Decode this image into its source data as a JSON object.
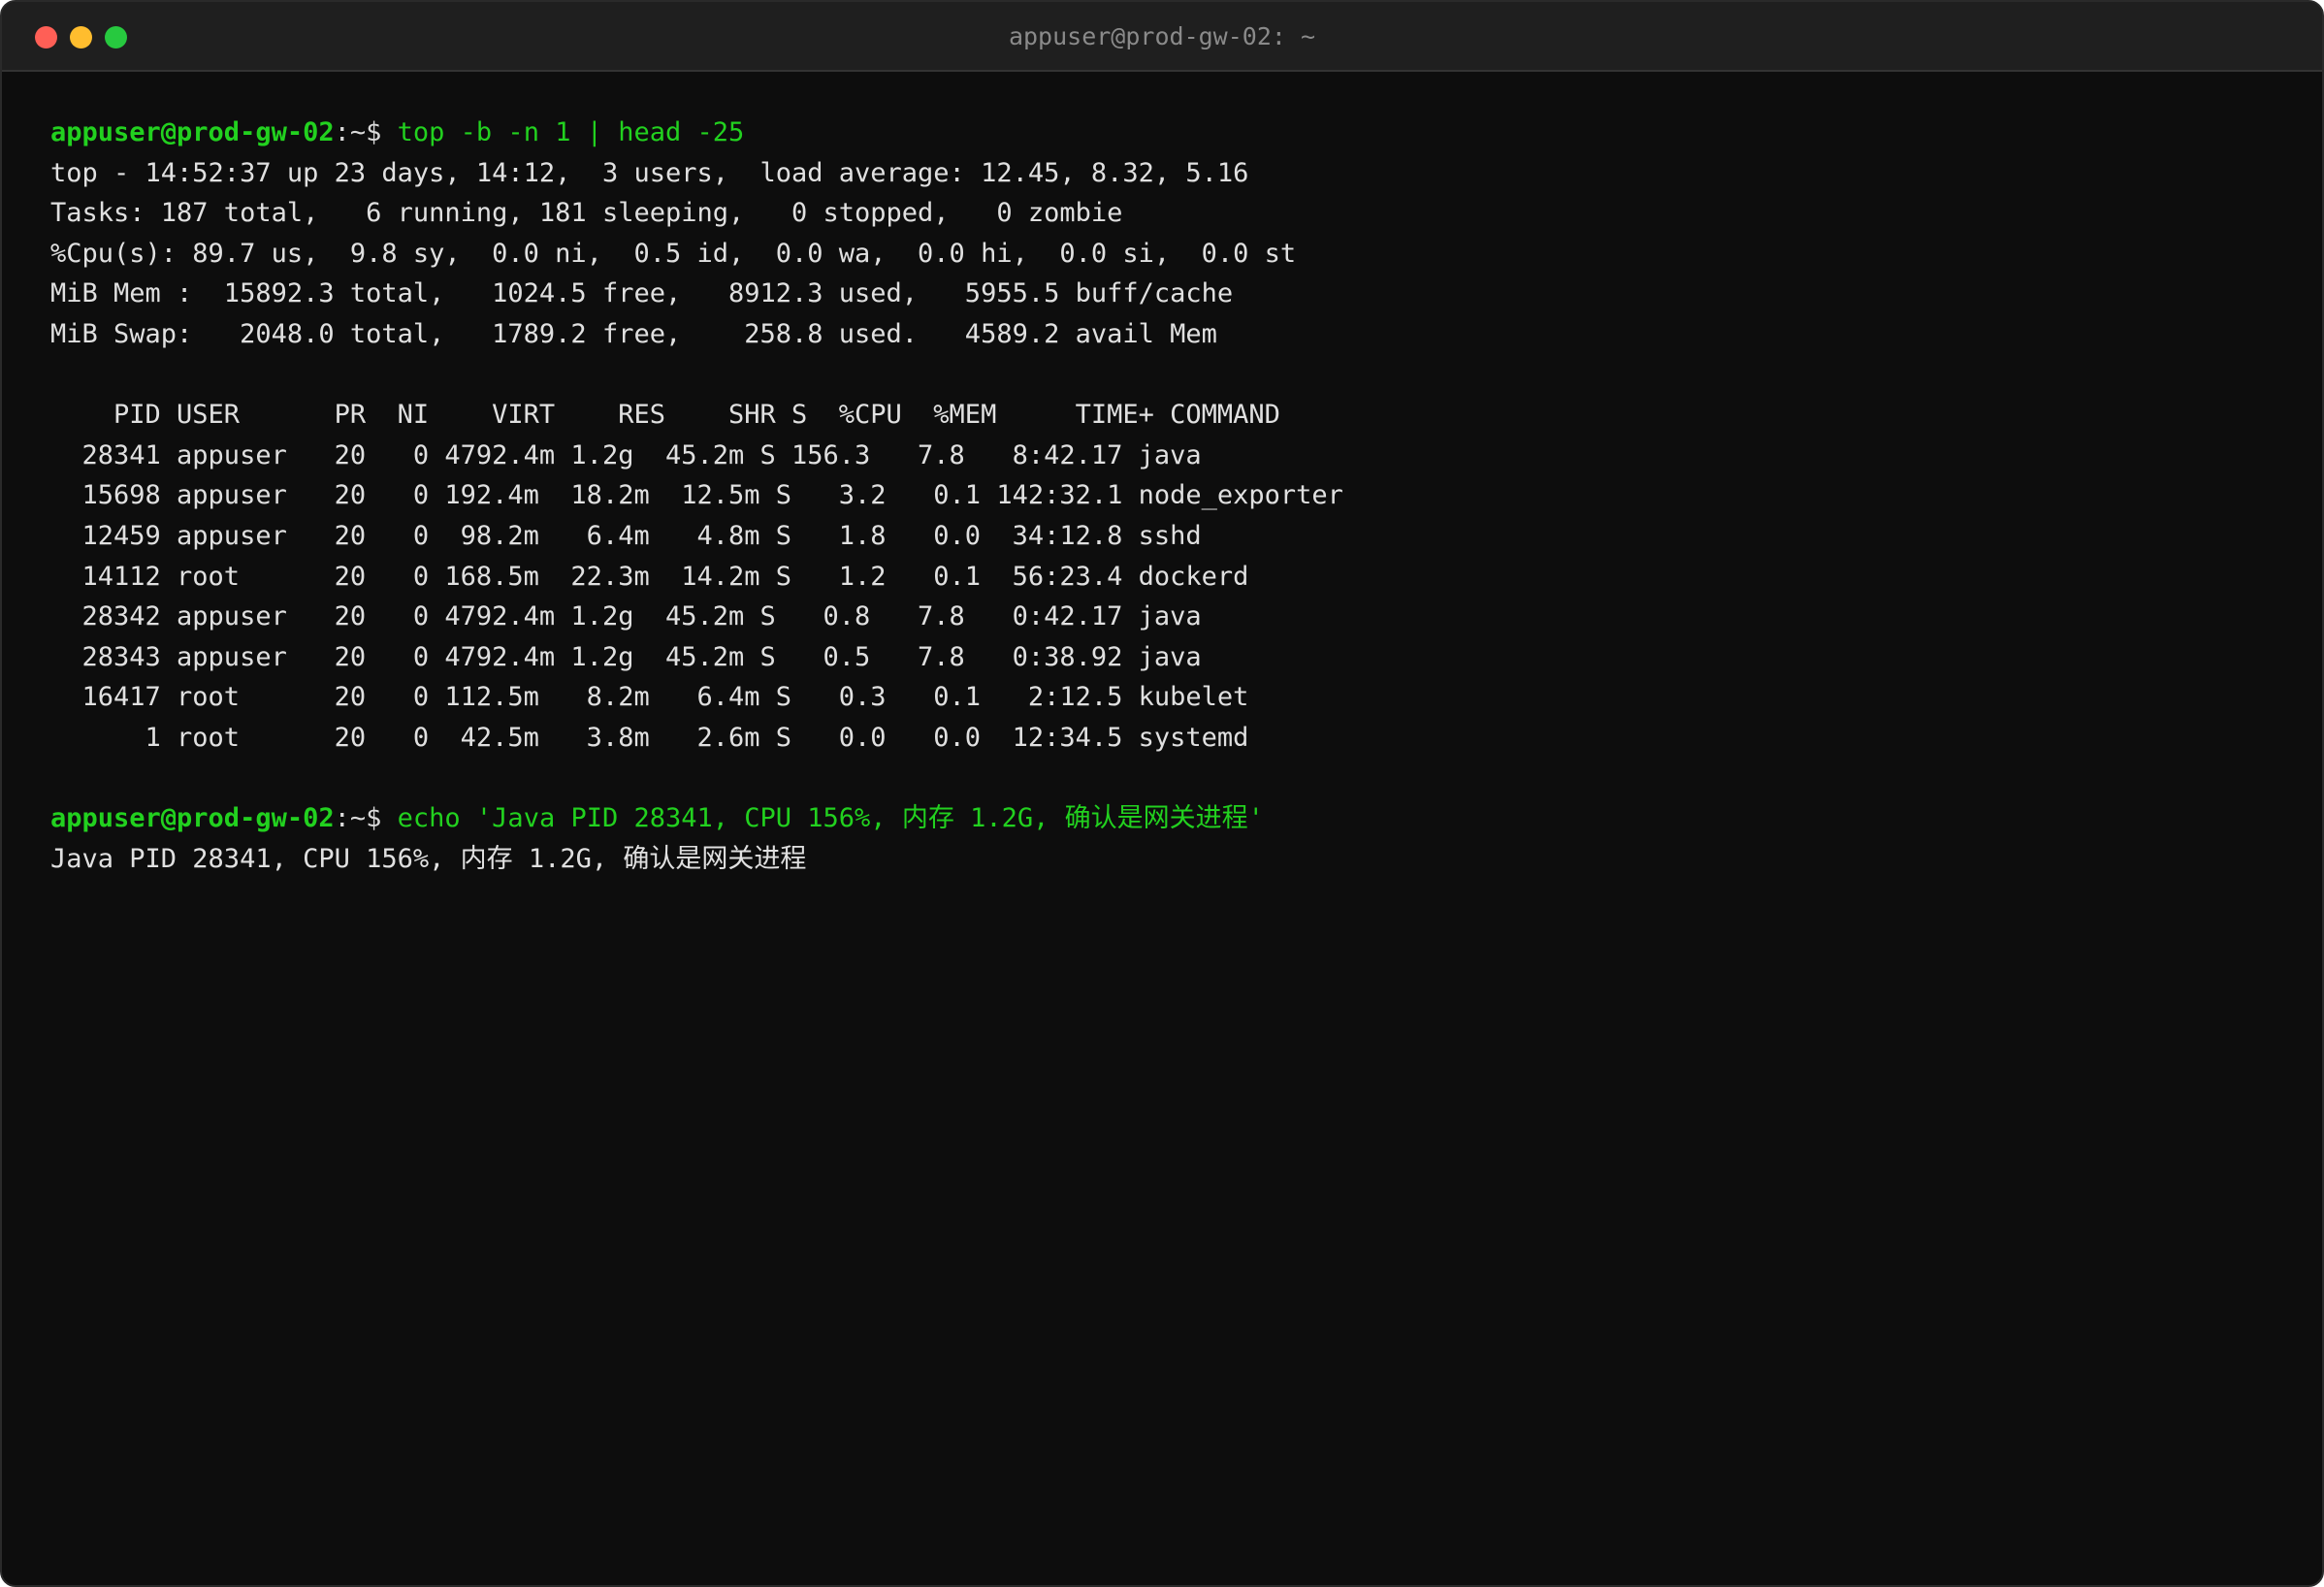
{
  "window": {
    "title": "appuser@prod-gw-02: ~",
    "bg": "#0d0d0d",
    "accent": "#22d11f"
  },
  "prompt": {
    "user_host": "appuser@prod-gw-02",
    "suffix": ":~$"
  },
  "commands": [
    " top -b -n 1 | head -25",
    " echo 'Java PID 28341, CPU 156%, 内存 1.2G, 确认是网关进程'"
  ],
  "top_summary": [
    "top - 14:52:37 up 23 days, 14:12,  3 users,  load average: 12.45, 8.32, 5.16",
    "Tasks: 187 total,   6 running, 181 sleeping,   0 stopped,   0 zombie",
    "%Cpu(s): 89.7 us,  9.8 sy,  0.0 ni,  0.5 id,  0.0 wa,  0.0 hi,  0.0 si,  0.0 st",
    "MiB Mem :  15892.3 total,   1024.5 free,   8912.3 used,   5955.5 buff/cache",
    "MiB Swap:   2048.0 total,   1789.2 free,    258.8 used.   4589.2 avail Mem"
  ],
  "process_header": "    PID USER      PR  NI    VIRT    RES    SHR S  %CPU  %MEM     TIME+ COMMAND",
  "processes": [
    "  28341 appuser   20   0 4792.4m 1.2g  45.2m S 156.3   7.8   8:42.17 java",
    "  15698 appuser   20   0 192.4m  18.2m  12.5m S   3.2   0.1 142:32.1 node_exporter",
    "  12459 appuser   20   0  98.2m   6.4m   4.8m S   1.8   0.0  34:12.8 sshd",
    "  14112 root      20   0 168.5m  22.3m  14.2m S   1.2   0.1  56:23.4 dockerd",
    "  28342 appuser   20   0 4792.4m 1.2g  45.2m S   0.8   7.8   0:42.17 java",
    "  28343 appuser   20   0 4792.4m 1.2g  45.2m S   0.5   7.8   0:38.92 java",
    "  16417 root      20   0 112.5m   8.2m   6.4m S   0.3   0.1   2:12.5 kubelet",
    "      1 root      20   0  42.5m   3.8m   2.6m S   0.0   0.0  12:34.5 systemd"
  ],
  "echo_output": "Java PID 28341, CPU 156%, 内存 1.2G, 确认是网关进程"
}
